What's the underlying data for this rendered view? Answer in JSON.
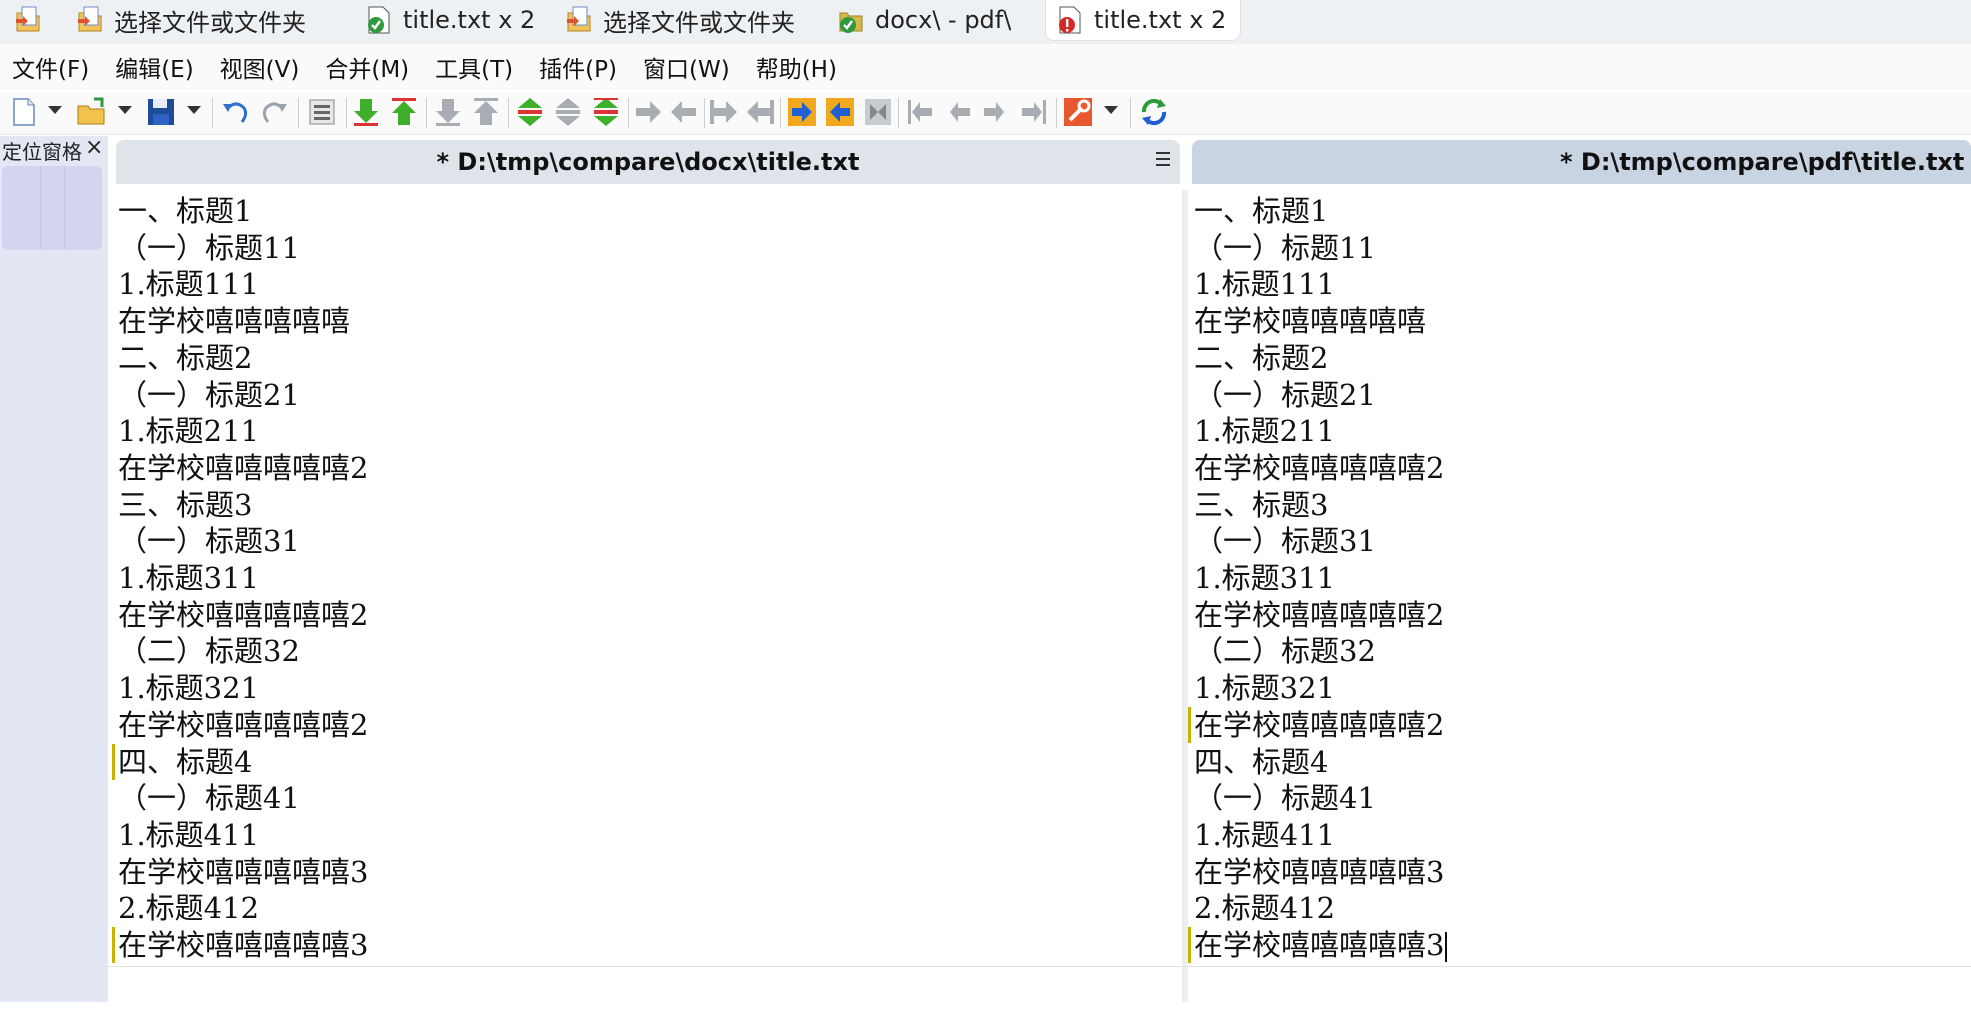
{
  "tabs": [
    {
      "label": "",
      "icon": "folder-compare-icon"
    },
    {
      "label": "选择文件或文件夹",
      "icon": "folder-compare-icon"
    },
    {
      "label": "title.txt x 2",
      "icon": "file-equal-icon"
    },
    {
      "label": "选择文件或文件夹",
      "icon": "folder-compare-icon"
    },
    {
      "label": "docx\\ - pdf\\",
      "icon": "folder-equal-icon"
    },
    {
      "label": "title.txt x 2",
      "icon": "file-diff-icon",
      "active": true
    }
  ],
  "menu": [
    "文件(F)",
    "编辑(E)",
    "视图(V)",
    "合并(M)",
    "工具(T)",
    "插件(P)",
    "窗口(W)",
    "帮助(H)"
  ],
  "toolbar": [
    "new-file-icon",
    "open-file-icon",
    "save-icon",
    "undo-icon",
    "redo-icon",
    "options-icon",
    "next-diff-icon",
    "prev-diff-icon",
    "first-diff-icon",
    "last-diff-icon",
    "current-diff-icon",
    "copy-right-icon",
    "copy-left-icon",
    "copy-right-advance-icon",
    "copy-left-advance-icon",
    "merge-right-icon",
    "merge-left-icon",
    "all-merge-icon",
    "go-first-icon",
    "go-prev-icon",
    "go-next-icon",
    "go-last-icon",
    "tools-icon",
    "refresh-icon"
  ],
  "locator": {
    "title": "定位窗格",
    "close": "×"
  },
  "left_pane": {
    "title": "* D:\\tmp\\compare\\docx\\title.txt",
    "menu_icon": "hamburger-icon",
    "lines": [
      "一、标题1",
      "（一）标题11",
      "1.标题111",
      "在学校嘻嘻嘻嘻嘻",
      "二、标题2",
      "（一）标题21",
      "1.标题211",
      "在学校嘻嘻嘻嘻嘻2",
      "三、标题3",
      "（一）标题31",
      "1.标题311",
      "在学校嘻嘻嘻嘻嘻2",
      "（二）标题32",
      "1.标题321",
      "在学校嘻嘻嘻嘻嘻2",
      "四、标题4",
      "（一）标题41",
      "1.标题411",
      "在学校嘻嘻嘻嘻嘻3",
      "2.标题412",
      "在学校嘻嘻嘻嘻嘻3"
    ],
    "marked_lines": [
      15,
      20
    ]
  },
  "right_pane": {
    "title": "* D:\\tmp\\compare\\pdf\\title.txt",
    "lines": [
      "一、标题1",
      "（一）标题11",
      "1.标题111",
      "在学校嘻嘻嘻嘻嘻",
      "二、标题2",
      "（一）标题21",
      "1.标题211",
      "在学校嘻嘻嘻嘻嘻2",
      "三、标题3",
      "（一）标题31",
      "1.标题311",
      "在学校嘻嘻嘻嘻嘻2",
      "（二）标题32",
      "1.标题321",
      "在学校嘻嘻嘻嘻嘻2",
      "四、标题4",
      "（一）标题41",
      "1.标题411",
      "在学校嘻嘻嘻嘻嘻3",
      "2.标题412",
      "在学校嘻嘻嘻嘻嘻3"
    ],
    "marked_lines": [
      14,
      20
    ],
    "caret_line": 20
  },
  "colors": {
    "marker": "#c8b400",
    "active_header": "#c9d4e2",
    "header": "#dfe3ea",
    "locator": "#e3e6f3"
  }
}
